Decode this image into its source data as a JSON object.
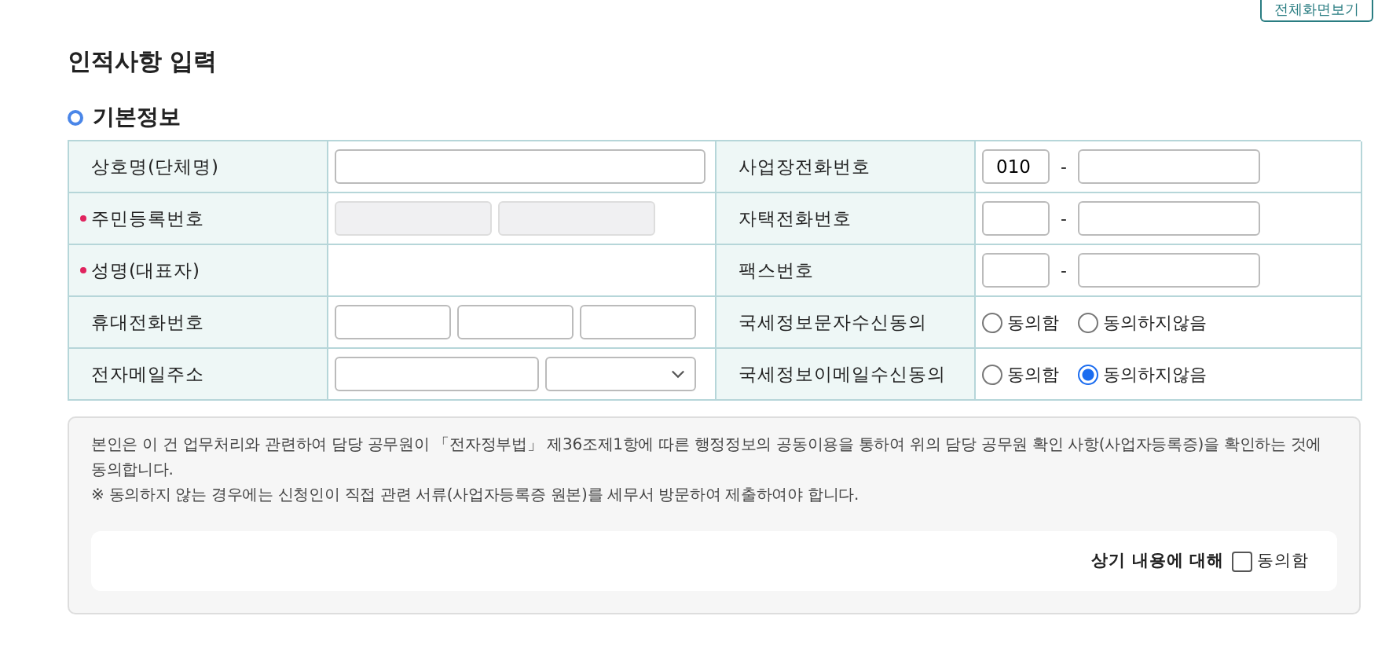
{
  "header_button": "전체화면보기",
  "title": "인적사항 입력",
  "section": "기본정보",
  "fields": [
    {
      "label": "상호명(단체명)",
      "required": false,
      "kind": "text"
    },
    {
      "label": "사업장전화번호",
      "required": false,
      "kind": "phone",
      "first": "010",
      "separator": "-"
    },
    {
      "label": "주민등록번호",
      "required": true,
      "kind": "pair"
    },
    {
      "label": "자택전화번호",
      "required": false,
      "kind": "phone",
      "separator": "-"
    },
    {
      "label": "성명(대표자)",
      "required": true,
      "kind": "plain"
    },
    {
      "label": "팩스번호",
      "required": false,
      "kind": "phone",
      "separator": "-"
    },
    {
      "label": "휴대전화번호",
      "required": false,
      "kind": "triple"
    },
    {
      "label": "국세정보문자수신동의",
      "required": false,
      "kind": "radio",
      "options": [
        {
          "label": "동의함",
          "selected": false
        },
        {
          "label": "동의하지않음",
          "selected": false
        }
      ]
    },
    {
      "label": "전자메일주소",
      "required": false,
      "kind": "email"
    },
    {
      "label": "국세정보이메일수신동의",
      "required": false,
      "kind": "radio",
      "options": [
        {
          "label": "동의함",
          "selected": false
        },
        {
          "label": "동의하지않음",
          "selected": true
        }
      ]
    }
  ],
  "notice": {
    "paragraphs": [
      "본인은 이 건 업무처리와 관련하여 담당 공무원이 「전자정부법」 제36조제1항에 따른 행정정보의 공동이용을 통하여 위의 담당 공무원 확인 사항(사업자등록증)을 확인하는 것에 동의합니다.",
      "※  동의하지 않는 경우에는 신청인이 직접 관련 서류(사업자등록증 원본)를 세무서 방문하여 제출하여야 합니다."
    ],
    "agree_prompt": "상기 내용에 대해",
    "agree_label": "동의함",
    "agree_checked": false
  }
}
